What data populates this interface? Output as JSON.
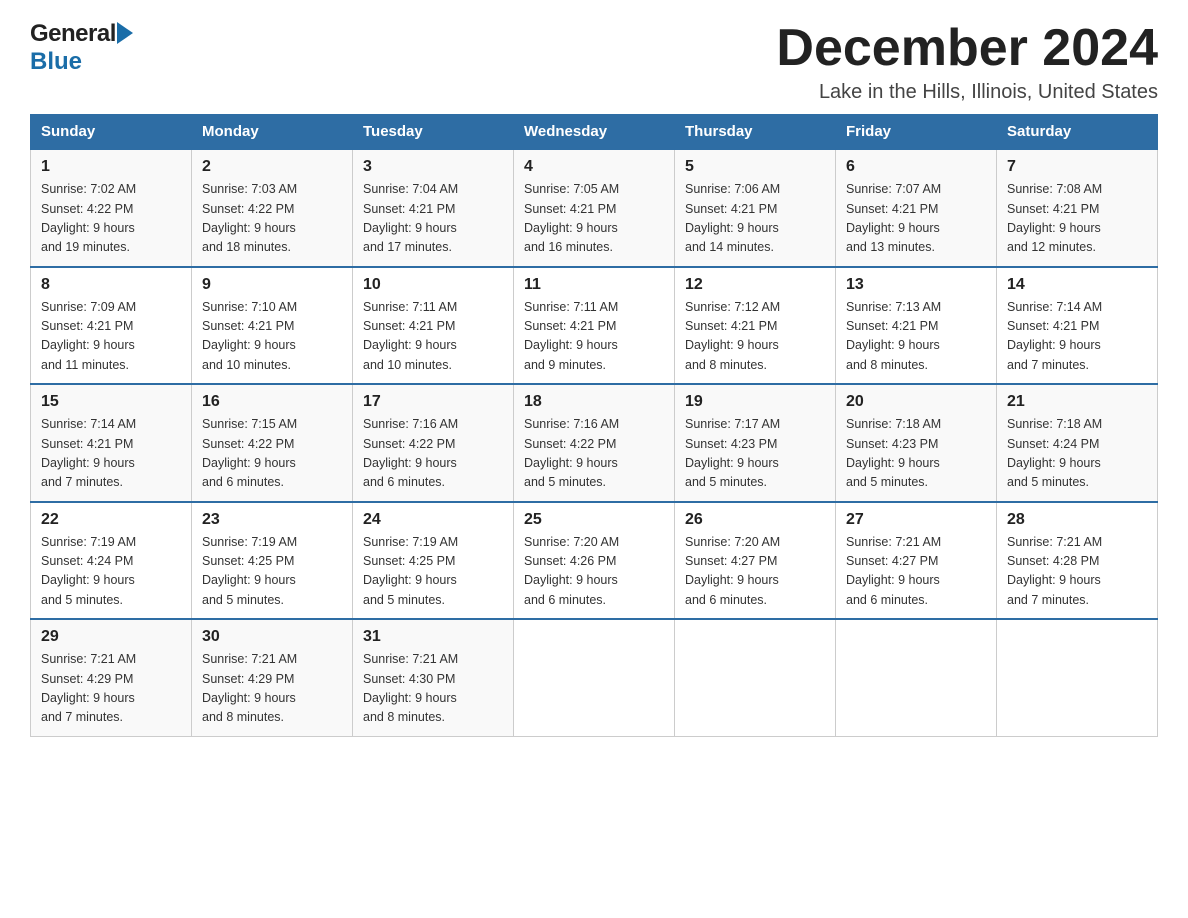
{
  "header": {
    "logo_general": "General",
    "logo_blue": "Blue",
    "month_title": "December 2024",
    "location": "Lake in the Hills, Illinois, United States"
  },
  "days_of_week": [
    "Sunday",
    "Monday",
    "Tuesday",
    "Wednesday",
    "Thursday",
    "Friday",
    "Saturday"
  ],
  "weeks": [
    [
      {
        "day": "1",
        "sunrise": "7:02 AM",
        "sunset": "4:22 PM",
        "daylight": "9 hours and 19 minutes."
      },
      {
        "day": "2",
        "sunrise": "7:03 AM",
        "sunset": "4:22 PM",
        "daylight": "9 hours and 18 minutes."
      },
      {
        "day": "3",
        "sunrise": "7:04 AM",
        "sunset": "4:21 PM",
        "daylight": "9 hours and 17 minutes."
      },
      {
        "day": "4",
        "sunrise": "7:05 AM",
        "sunset": "4:21 PM",
        "daylight": "9 hours and 16 minutes."
      },
      {
        "day": "5",
        "sunrise": "7:06 AM",
        "sunset": "4:21 PM",
        "daylight": "9 hours and 14 minutes."
      },
      {
        "day": "6",
        "sunrise": "7:07 AM",
        "sunset": "4:21 PM",
        "daylight": "9 hours and 13 minutes."
      },
      {
        "day": "7",
        "sunrise": "7:08 AM",
        "sunset": "4:21 PM",
        "daylight": "9 hours and 12 minutes."
      }
    ],
    [
      {
        "day": "8",
        "sunrise": "7:09 AM",
        "sunset": "4:21 PM",
        "daylight": "9 hours and 11 minutes."
      },
      {
        "day": "9",
        "sunrise": "7:10 AM",
        "sunset": "4:21 PM",
        "daylight": "9 hours and 10 minutes."
      },
      {
        "day": "10",
        "sunrise": "7:11 AM",
        "sunset": "4:21 PM",
        "daylight": "9 hours and 10 minutes."
      },
      {
        "day": "11",
        "sunrise": "7:11 AM",
        "sunset": "4:21 PM",
        "daylight": "9 hours and 9 minutes."
      },
      {
        "day": "12",
        "sunrise": "7:12 AM",
        "sunset": "4:21 PM",
        "daylight": "9 hours and 8 minutes."
      },
      {
        "day": "13",
        "sunrise": "7:13 AM",
        "sunset": "4:21 PM",
        "daylight": "9 hours and 8 minutes."
      },
      {
        "day": "14",
        "sunrise": "7:14 AM",
        "sunset": "4:21 PM",
        "daylight": "9 hours and 7 minutes."
      }
    ],
    [
      {
        "day": "15",
        "sunrise": "7:14 AM",
        "sunset": "4:21 PM",
        "daylight": "9 hours and 7 minutes."
      },
      {
        "day": "16",
        "sunrise": "7:15 AM",
        "sunset": "4:22 PM",
        "daylight": "9 hours and 6 minutes."
      },
      {
        "day": "17",
        "sunrise": "7:16 AM",
        "sunset": "4:22 PM",
        "daylight": "9 hours and 6 minutes."
      },
      {
        "day": "18",
        "sunrise": "7:16 AM",
        "sunset": "4:22 PM",
        "daylight": "9 hours and 5 minutes."
      },
      {
        "day": "19",
        "sunrise": "7:17 AM",
        "sunset": "4:23 PM",
        "daylight": "9 hours and 5 minutes."
      },
      {
        "day": "20",
        "sunrise": "7:18 AM",
        "sunset": "4:23 PM",
        "daylight": "9 hours and 5 minutes."
      },
      {
        "day": "21",
        "sunrise": "7:18 AM",
        "sunset": "4:24 PM",
        "daylight": "9 hours and 5 minutes."
      }
    ],
    [
      {
        "day": "22",
        "sunrise": "7:19 AM",
        "sunset": "4:24 PM",
        "daylight": "9 hours and 5 minutes."
      },
      {
        "day": "23",
        "sunrise": "7:19 AM",
        "sunset": "4:25 PM",
        "daylight": "9 hours and 5 minutes."
      },
      {
        "day": "24",
        "sunrise": "7:19 AM",
        "sunset": "4:25 PM",
        "daylight": "9 hours and 5 minutes."
      },
      {
        "day": "25",
        "sunrise": "7:20 AM",
        "sunset": "4:26 PM",
        "daylight": "9 hours and 6 minutes."
      },
      {
        "day": "26",
        "sunrise": "7:20 AM",
        "sunset": "4:27 PM",
        "daylight": "9 hours and 6 minutes."
      },
      {
        "day": "27",
        "sunrise": "7:21 AM",
        "sunset": "4:27 PM",
        "daylight": "9 hours and 6 minutes."
      },
      {
        "day": "28",
        "sunrise": "7:21 AM",
        "sunset": "4:28 PM",
        "daylight": "9 hours and 7 minutes."
      }
    ],
    [
      {
        "day": "29",
        "sunrise": "7:21 AM",
        "sunset": "4:29 PM",
        "daylight": "9 hours and 7 minutes."
      },
      {
        "day": "30",
        "sunrise": "7:21 AM",
        "sunset": "4:29 PM",
        "daylight": "9 hours and 8 minutes."
      },
      {
        "day": "31",
        "sunrise": "7:21 AM",
        "sunset": "4:30 PM",
        "daylight": "9 hours and 8 minutes."
      },
      null,
      null,
      null,
      null
    ]
  ],
  "labels": {
    "sunrise": "Sunrise: ",
    "sunset": "Sunset: ",
    "daylight": "Daylight: "
  }
}
